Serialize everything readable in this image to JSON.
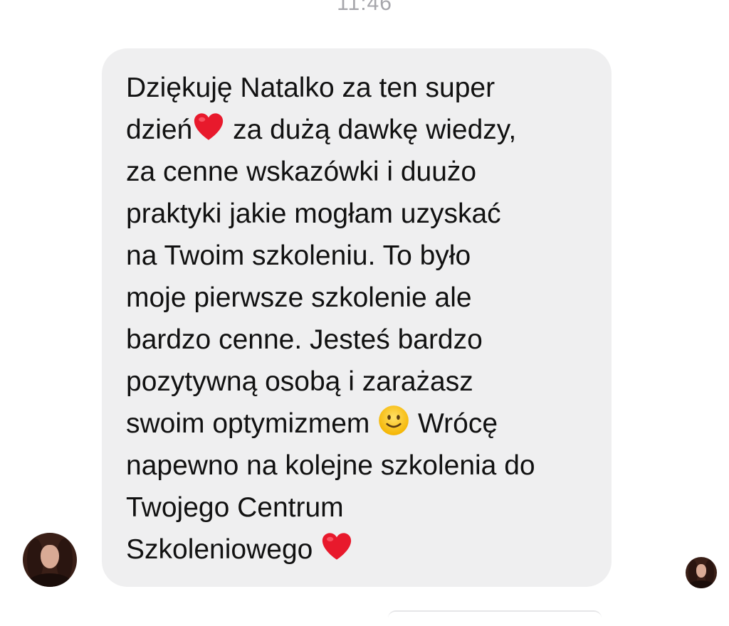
{
  "header": {
    "timestamp": "11:46"
  },
  "message": {
    "segments": [
      {
        "type": "text",
        "value": "Dziękuję Natalko za ten super\ndzień"
      },
      {
        "type": "emoji",
        "icon": "red-heart-emoji"
      },
      {
        "type": "text",
        "value": " za dużą dawkę wiedzy,\nza cenne wskazówki i duużo\npraktyki jakie mogłam uzyskać\nna Twoim szkoleniu. To było\nmoje pierwsze szkolenie ale\nbardzo cenne. Jesteś bardzo\npozytywną osobą i zarażasz\nswoim optymizmem "
      },
      {
        "type": "emoji",
        "icon": "smiling-face-emoji"
      },
      {
        "type": "text",
        "value": " Wrócę\nnapewno na kolejne szkolenia do\nTwojego Centrum\nSzkoleniowego "
      },
      {
        "type": "emoji",
        "icon": "red-heart-emoji"
      }
    ]
  },
  "avatars": {
    "sender": "sender-avatar",
    "read_receipt": "read-receipt-avatar"
  },
  "colors": {
    "bubble_background": "#efeff0",
    "text": "#111111",
    "timestamp": "#a6a6ab",
    "heart": "#e8192c",
    "smiley": "#fbc02d"
  }
}
